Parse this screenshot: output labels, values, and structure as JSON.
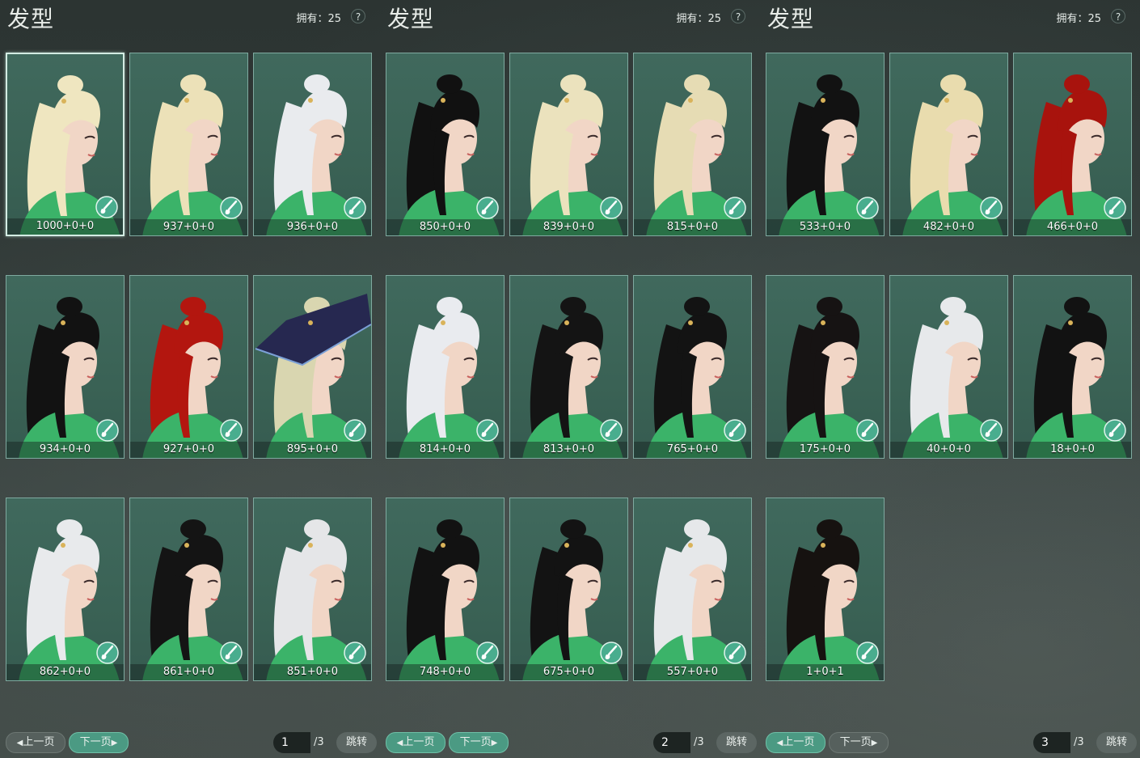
{
  "panels": [
    {
      "title": "发型",
      "owned": "拥有：25",
      "help": "?",
      "items": [
        {
          "label": "1000+0+0",
          "hair": "#efe6c0",
          "selected": true
        },
        {
          "label": "937+0+0",
          "hair": "#ece1b8"
        },
        {
          "label": "936+0+0",
          "hair": "#e9ebee"
        },
        {
          "label": "934+0+0",
          "hair": "#121212"
        },
        {
          "label": "927+0+0",
          "hair": "#b3160f"
        },
        {
          "label": "895+0+0",
          "hair": "#d9d6b0",
          "hat": "#262850"
        },
        {
          "label": "862+0+0",
          "hair": "#e8eaec"
        },
        {
          "label": "861+0+0",
          "hair": "#141414"
        },
        {
          "label": "851+0+0",
          "hair": "#e5e6e8"
        }
      ],
      "pager": {
        "prev": "上一页",
        "next": "下一页",
        "page": "1",
        "total": "/3",
        "jump": "跳转",
        "active": "next"
      }
    },
    {
      "title": "发型",
      "owned": "拥有：25",
      "help": "?",
      "items": [
        {
          "label": "850+0+0",
          "hair": "#111111"
        },
        {
          "label": "839+0+0",
          "hair": "#ebe2bd"
        },
        {
          "label": "815+0+0",
          "hair": "#e6dcb4"
        },
        {
          "label": "814+0+0",
          "hair": "#e9ebef"
        },
        {
          "label": "813+0+0",
          "hair": "#141414"
        },
        {
          "label": "765+0+0",
          "hair": "#131313"
        },
        {
          "label": "748+0+0",
          "hair": "#121212"
        },
        {
          "label": "675+0+0",
          "hair": "#131313"
        },
        {
          "label": "557+0+0",
          "hair": "#e6e8ea"
        }
      ],
      "pager": {
        "prev": "上一页",
        "next": "下一页",
        "page": "2",
        "total": "/3",
        "jump": "跳转",
        "active": "both"
      }
    },
    {
      "title": "发型",
      "owned": "拥有：25",
      "help": "?",
      "items": [
        {
          "label": "533+0+0",
          "hair": "#121212"
        },
        {
          "label": "482+0+0",
          "hair": "#e9dcae"
        },
        {
          "label": "466+0+0",
          "hair": "#a8130d"
        },
        {
          "label": "175+0+0",
          "hair": "#161313"
        },
        {
          "label": "40+0+0",
          "hair": "#e7e9eb"
        },
        {
          "label": "18+0+0",
          "hair": "#121212"
        },
        {
          "label": "1+0+1",
          "hair": "#161210"
        }
      ],
      "pager": {
        "prev": "上一页",
        "next": "下一页",
        "page": "3",
        "total": "/3",
        "jump": "跳转",
        "active": "prev"
      }
    }
  ],
  "colors": {
    "skin": "#f1d6c6",
    "robe": "#3bb369",
    "dye_icon": "#49ad8e"
  }
}
